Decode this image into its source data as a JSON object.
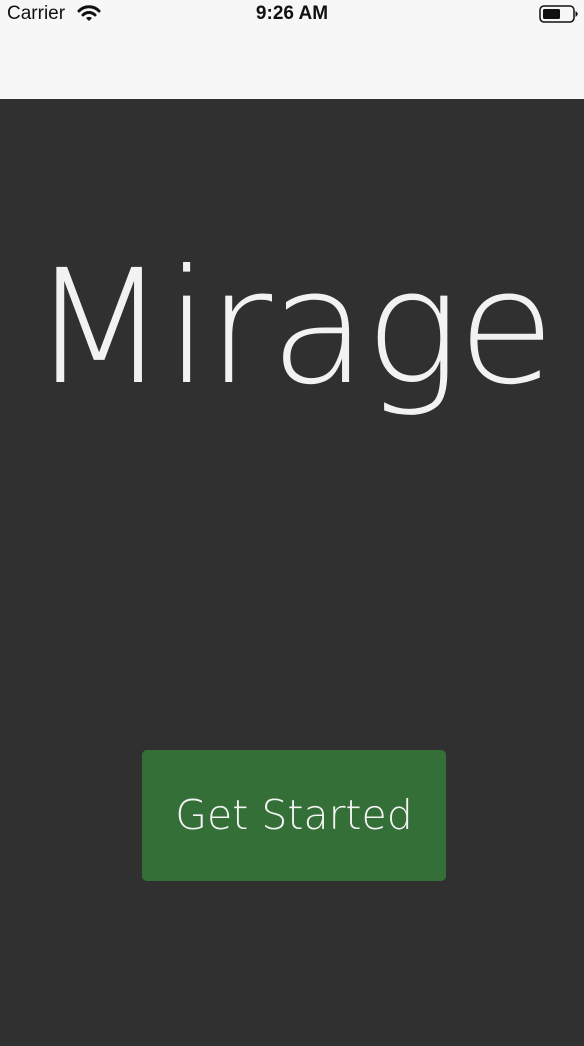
{
  "status_bar": {
    "carrier": "Carrier",
    "time": "9:26 AM",
    "icons": [
      "wifi-icon",
      "battery-icon"
    ]
  },
  "main": {
    "title": "Mirage",
    "get_started_label": "Get Started"
  },
  "colors": {
    "background": "#303030",
    "status_bar_bg": "#f7f7f7",
    "button_bg": "#346f37",
    "title_text": "#f2f2f2"
  }
}
